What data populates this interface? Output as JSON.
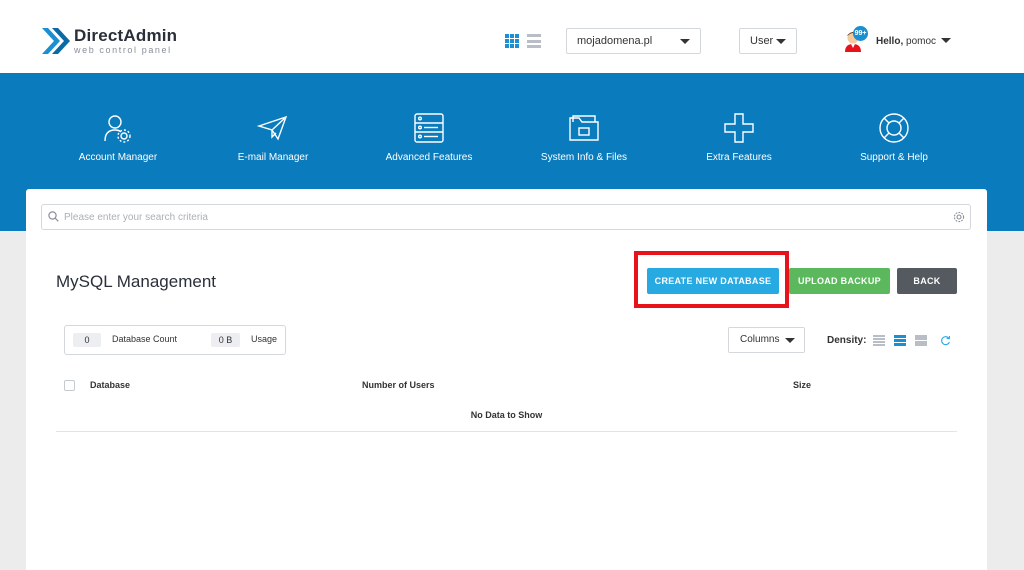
{
  "brand": {
    "title": "DirectAdmin",
    "subtitle": "web control panel",
    "accent": "#0a7bbd"
  },
  "header": {
    "view_grid_icon": "grid-view-icon",
    "view_list_icon": "list-view-icon",
    "domain": "mojadomena.pl",
    "role": "User",
    "notification_count": "99+",
    "greeting": "Hello,",
    "username": "pomoc"
  },
  "nav": [
    {
      "label": "Account Manager",
      "icon": "account-manager-icon"
    },
    {
      "label": "E-mail Manager",
      "icon": "paper-plane-icon"
    },
    {
      "label": "Advanced Features",
      "icon": "server-icon"
    },
    {
      "label": "System Info & Files",
      "icon": "folder-icon"
    },
    {
      "label": "Extra Features",
      "icon": "plus-icon"
    },
    {
      "label": "Support & Help",
      "icon": "lifebuoy-icon"
    }
  ],
  "search": {
    "placeholder": "Please enter your search criteria",
    "value": ""
  },
  "page": {
    "title": "MySQL Management"
  },
  "actions": {
    "create": "CREATE NEW DATABASE",
    "upload": "UPLOAD BACKUP",
    "back": "BACK",
    "create_color": "#27a9e1",
    "upload_color": "#5cb85c",
    "back_color": "#555a60",
    "highlight_color": "#e8121d"
  },
  "stats": {
    "database_count": "0",
    "database_count_label": "Database Count",
    "usage": "0 B",
    "usage_label": "Usage"
  },
  "table_controls": {
    "columns_label": "Columns",
    "density_label": "Density:"
  },
  "table": {
    "headers": [
      "Database",
      "Number of Users",
      "Size"
    ],
    "empty_message": "No Data to Show"
  }
}
